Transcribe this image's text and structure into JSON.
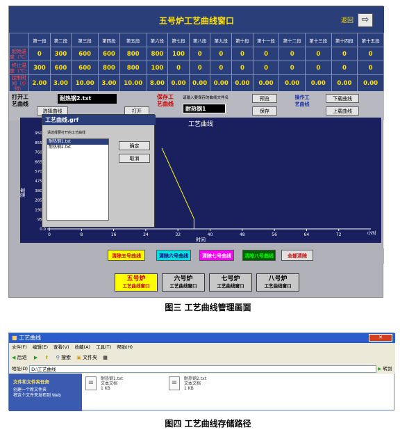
{
  "panel1": {
    "title": "五号炉工艺曲线窗口",
    "return_label": "返回",
    "return_icon": "arrow-right-icon",
    "columns": [
      "第一段",
      "第二段",
      "第三段",
      "第四段",
      "第五段",
      "第六段",
      "第七段",
      "第八段",
      "第九段",
      "第十段",
      "第十一段",
      "第十二段",
      "第十三段",
      "第十四段",
      "第十五段"
    ],
    "rows": [
      {
        "label": "起始温度（℃）",
        "values": [
          "0",
          "300",
          "600",
          "600",
          "800",
          "800",
          "100",
          "0",
          "0",
          "0",
          "0",
          "0",
          "0",
          "0",
          "0"
        ]
      },
      {
        "label": "终止温度（℃）",
        "values": [
          "300",
          "600",
          "600",
          "800",
          "800",
          "100",
          "0",
          "0",
          "0",
          "0",
          "0",
          "0",
          "0",
          "0",
          "0"
        ]
      },
      {
        "label": "控制时间（小时）",
        "values": [
          "2.00",
          "3.00",
          "10.00",
          "3.00",
          "10.00",
          "8.00",
          "0.00",
          "0.00",
          "0.00",
          "0.00",
          "0.00",
          "0.00",
          "0.00",
          "0.00",
          "0.00"
        ]
      }
    ],
    "open_label": "打开工艺曲线",
    "open_file_value": "耐热钢2.txt",
    "select_curve_button": "选择曲线",
    "open_button": "打开",
    "save_label": "保存工艺曲线",
    "save_hint": "请输入要保存的曲线文件名",
    "save_file_value": "耐热钢1",
    "preview_button": "预览",
    "save_button": "保存",
    "operate_label": "操作工艺曲线",
    "download_button": "下载曲线",
    "upload_button": "上载曲线"
  },
  "chart_data": {
    "type": "line",
    "title": "工艺曲线",
    "xlabel": "时间",
    "ylabel": "温度",
    "x_ticks": [
      "0",
      "8",
      "16",
      "24",
      "32",
      "40",
      "48",
      "56",
      "64",
      "72"
    ],
    "x_end_label": "小时",
    "y_ticks": [
      "0.0",
      "95.0",
      "190.0",
      "285.0",
      "380.0",
      "475.0",
      "570.0",
      "665.0",
      "760.0",
      "855.0",
      "950.0"
    ],
    "ylim": [
      0,
      950
    ],
    "xlim": [
      0,
      80
    ],
    "series": [
      {
        "x": [
          28,
          36
        ],
        "y": [
          800,
          100
        ],
        "color": "#ffff00"
      }
    ],
    "marker_x": 36
  },
  "dialog": {
    "title": "工艺曲线.grf",
    "list_caption": "请选择要打开的工艺曲线",
    "files": [
      "耐热钢1.txt",
      "耐热钢2.txt"
    ],
    "selected_index": 0,
    "ok_button": "确定",
    "cancel_button": "取消"
  },
  "clear_buttons": [
    {
      "label": "清除五号曲线",
      "bg": "#ffff00",
      "color": "#cc0000"
    },
    {
      "label": "清除六号曲线",
      "bg": "#00e0e0",
      "color": "#000080"
    },
    {
      "label": "清除七号曲线",
      "bg": "#ff00ff",
      "color": "#ffffff"
    },
    {
      "label": "清除八号曲线",
      "bg": "#006000",
      "color": "#00ff00"
    },
    {
      "label": "全部清除",
      "bg": "#e0e0e0",
      "color": "#cc0000"
    }
  ],
  "furnace_buttons": [
    {
      "label": "五号炉",
      "sub": "工艺曲线窗口",
      "bg": "#ffff00",
      "color": "#cc0000"
    },
    {
      "label": "六号炉",
      "sub": "工艺曲线窗口",
      "bg": "#c8c8c8",
      "color": "#000000"
    },
    {
      "label": "七号炉",
      "sub": "工艺曲线窗口",
      "bg": "#c8c8c8",
      "color": "#000000"
    },
    {
      "label": "八号炉",
      "sub": "工艺曲线窗口",
      "bg": "#c8c8c8",
      "color": "#000000"
    }
  ],
  "caption1": "图三   工艺曲线管理画面",
  "explorer": {
    "title": "工艺曲线",
    "menu": [
      "文件(F)",
      "编辑(E)",
      "查看(V)",
      "收藏(A)",
      "工具(T)",
      "帮助(H)"
    ],
    "back_label": "后退",
    "search_label": "搜索",
    "folders_label": "文件夹",
    "address_label": "地址(D)",
    "address_value": "D:\\工艺曲线",
    "go_label": "转到",
    "side_title": "文件和文件夹任务",
    "side_items": [
      "创建一个新文件夹",
      "将这个文件夹发布到 Web"
    ],
    "files": [
      {
        "name": "耐热钢1.txt",
        "type": "文本文档",
        "size": "1 KB"
      },
      {
        "name": "耐热钢2.txt",
        "type": "文本文档",
        "size": "1 KB"
      }
    ]
  },
  "caption2": "图四   工艺曲线存储路径"
}
